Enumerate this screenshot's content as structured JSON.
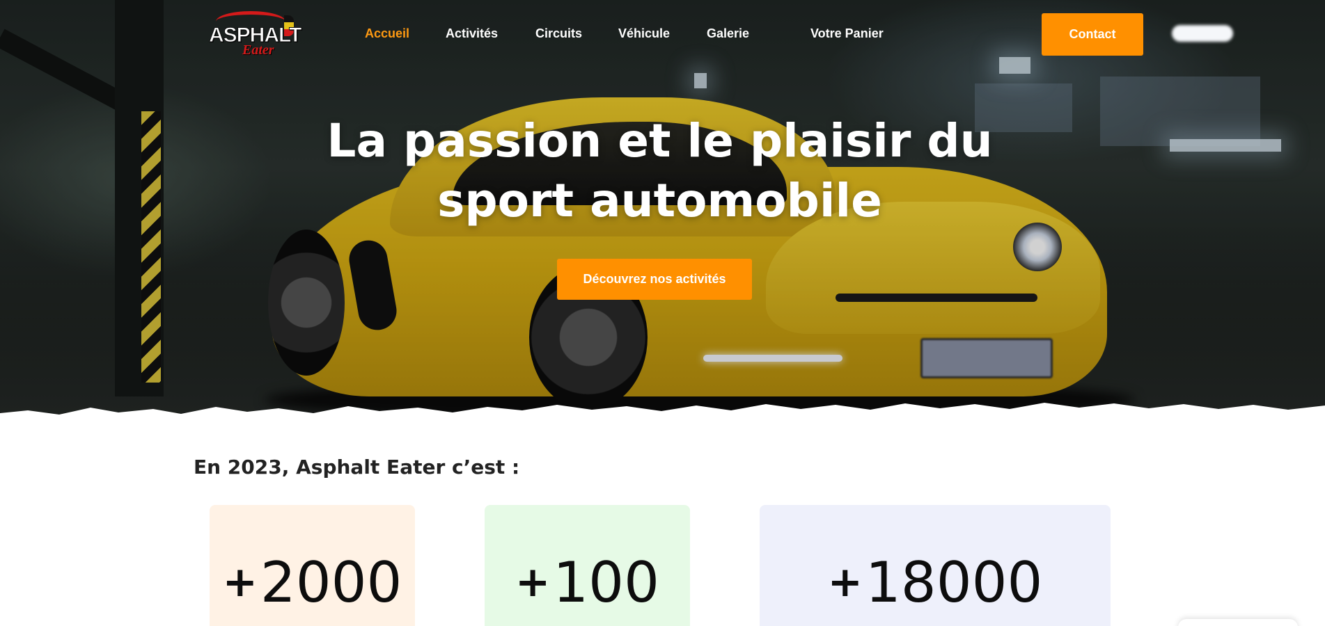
{
  "brand": {
    "logo_main": "ASPHALT",
    "logo_sub": "Eater"
  },
  "nav": {
    "items": [
      {
        "label": "Accueil",
        "active": true
      },
      {
        "label": "Activités",
        "active": false
      },
      {
        "label": "Circuits",
        "active": false
      },
      {
        "label": "Véhicule",
        "active": false
      },
      {
        "label": "Galerie",
        "active": false
      },
      {
        "label": "Votre Panier",
        "active": false
      }
    ],
    "contact_label": "Contact"
  },
  "hero": {
    "title": "La passion et le plaisir du sport automobile",
    "cta_label": "Découvrez nos activités"
  },
  "stats": {
    "heading": "En 2023, Asphalt Eater c’est :",
    "cards": [
      {
        "plus": "+",
        "value": "2000",
        "bg": "#fff2e5"
      },
      {
        "plus": "+",
        "value": "100",
        "bg": "#e6fae6"
      },
      {
        "plus": "+",
        "value": "18000",
        "bg": "#eef0fb"
      }
    ]
  },
  "colors": {
    "accent": "#ff9000",
    "active_nav": "#ff9a12"
  }
}
